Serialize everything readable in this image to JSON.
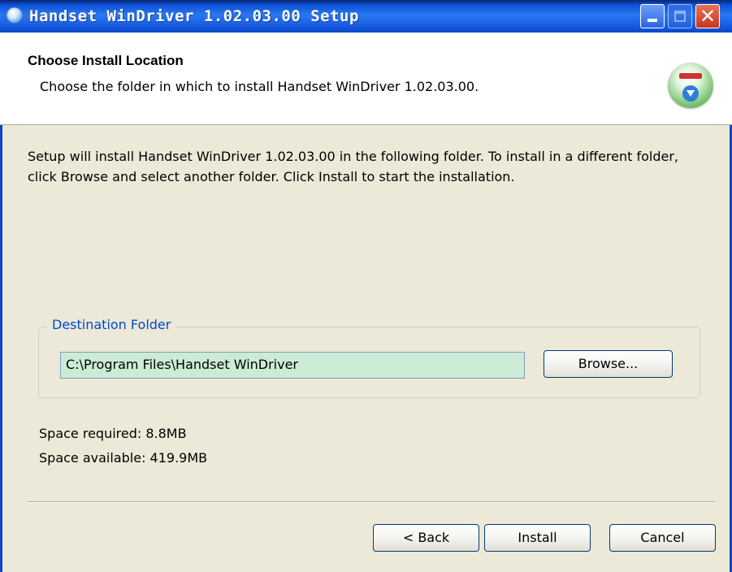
{
  "window": {
    "title": "Handset WinDriver 1.02.03.00 Setup",
    "controls": {
      "minimize": "minimize",
      "maximize": "maximize",
      "close": "✕"
    }
  },
  "header": {
    "title": "Choose Install Location",
    "subtitle": "Choose the folder in which to install Handset WinDriver 1.02.03.00.",
    "icon": "installer-icon"
  },
  "body": {
    "description": "Setup will install Handset WinDriver 1.02.03.00 in the following folder. To install in a different folder, click Browse and select another folder. Click Install to start the installation.",
    "destination": {
      "legend": "Destination Folder",
      "path": "C:\\Program Files\\Handset WinDriver",
      "browse_label": "Browse..."
    },
    "space_required": "Space required: 8.8MB",
    "space_available": "Space available: 419.9MB"
  },
  "footer": {
    "back_label": "< Back",
    "install_label": "Install",
    "cancel_label": "Cancel"
  },
  "colors": {
    "titlebar": "#0B4FD6",
    "dialog_bg": "#ECE9D8",
    "path_field_bg": "#CCEBD5",
    "legend_text": "#0046D5"
  }
}
